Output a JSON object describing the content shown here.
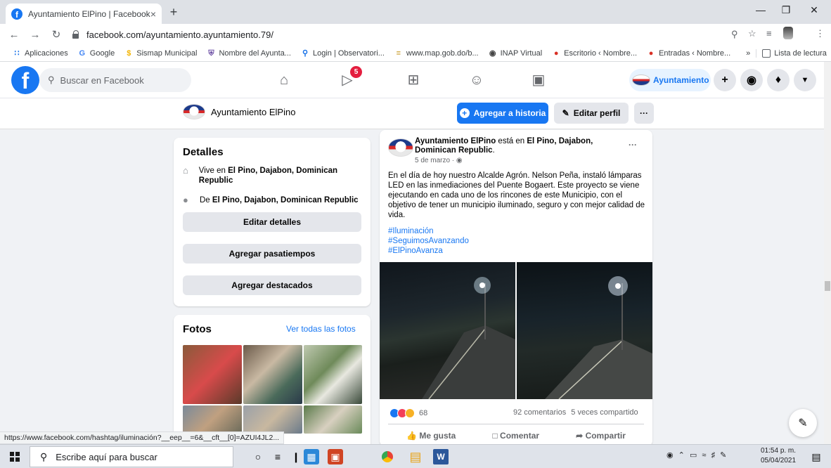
{
  "browser": {
    "tab_title": "Ayuntamiento ElPino | Facebook",
    "tab_close": "×",
    "new_tab": "+",
    "url": "facebook.com/ayuntamiento.ayuntamiento.79/",
    "bookmarks": [
      "Aplicaciones",
      "Google",
      "Sismap Municipal",
      "Nombre del Ayunta...",
      "Login | Observatori...",
      "www.map.gob.do/b...",
      "INAP Virtual",
      "Escritorio ‹ Nombre...",
      "Entradas ‹ Nombre..."
    ],
    "bookmarks_more": "»",
    "reading_list": "Lista de lectura",
    "status_url": "https://www.facebook.com/hashtag/iluminación?__eep__=6&__cft__[0]=AZUI4JL2..."
  },
  "fb_nav": {
    "search_placeholder": "Buscar en Facebook",
    "watch_badge": "5",
    "profile_chip": "Ayuntamiento"
  },
  "profile": {
    "name": "Ayuntamiento ElPino",
    "add_story": "Agregar a historia",
    "edit_profile": "Editar perfil",
    "more": "···"
  },
  "details": {
    "title": "Detalles",
    "lives_prefix": "Vive en ",
    "lives_place": "El Pino, Dajabon, Dominican Republic",
    "from_prefix": "De ",
    "from_place": "El Pino, Dajabon, Dominican Republic",
    "edit_details": "Editar detalles",
    "add_hobbies": "Agregar pasatiempos",
    "add_featured": "Agregar destacados"
  },
  "photos": {
    "title": "Fotos",
    "see_all": "Ver todas las fotos"
  },
  "post": {
    "author": "Ayuntamiento ElPino",
    "is_at": " está en ",
    "place": "El Pino, Dajabon, Dominican Republic",
    "date": "5 de marzo · ",
    "more": "···",
    "text": "En el día de hoy nuestro Alcalde Agrón.  Nelson Peña, instaló lámparas LED en las inmediaciones del Puente Bogaert. Este proyecto se viene ejecutando en cada uno de los rincones de este Municipio, con el objetivo de tener un municipio iluminado, seguro y con mejor calidad de vida.",
    "hashtags": [
      "#Iluminación",
      "#SeguimosAvanzando",
      "#ElPinoAvanza"
    ],
    "reactions_count": "68",
    "comments": "92 comentarios",
    "shares": "5 veces compartido",
    "like": "Me gusta",
    "comment": "Comentar",
    "share": "Compartir"
  },
  "taskbar": {
    "search_placeholder": "Escribe aquí para buscar",
    "time": "01:54 p. m.",
    "date": "05/04/2021"
  },
  "colors": {
    "fb_blue": "#1877f2",
    "bg": "#f0f2f5",
    "badge_red": "#e41e3f"
  }
}
